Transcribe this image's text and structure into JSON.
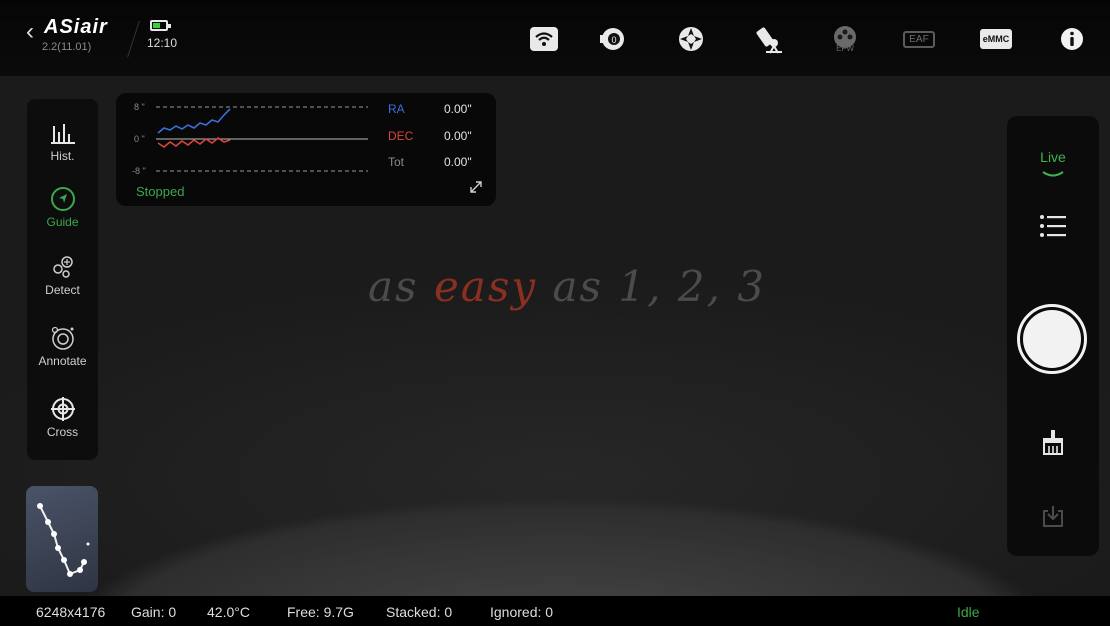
{
  "app": {
    "brand": "ASiair",
    "version": "2.2(11.01)",
    "clock": "12:10"
  },
  "topbar": {
    "icons": [
      "wifi-icon",
      "camera-icon",
      "guide-scope-icon",
      "mount-icon",
      "efw-icon",
      "eaf-icon",
      "emmc-icon",
      "info-icon"
    ],
    "efw_label": "EFW",
    "eaf_label": "EAF",
    "emmc_label": "eMMC"
  },
  "left_tools": [
    {
      "label": "Hist.",
      "icon": "histogram-icon",
      "active": false
    },
    {
      "label": "Guide",
      "icon": "guide-arrow-icon",
      "active": true
    },
    {
      "label": "Detect",
      "icon": "detect-stars-icon",
      "active": false
    },
    {
      "label": "Annotate",
      "icon": "annotate-icon",
      "active": false
    },
    {
      "label": "Cross",
      "icon": "crosshair-icon",
      "active": false
    }
  ],
  "guide_panel": {
    "ticks": [
      "8 \"",
      "0 \"",
      "-8 \""
    ],
    "rows": [
      {
        "label": "RA",
        "value": "0.00\"",
        "color": "#3d6fd8"
      },
      {
        "label": "DEC",
        "value": "0.00\"",
        "color": "#d8453d"
      },
      {
        "label": "Tot",
        "value": "0.00\"",
        "color": "#8a8a8a"
      }
    ],
    "status": "Stopped"
  },
  "slogan": {
    "part1": "as ",
    "highlight": "easy",
    "part2": " as 1, 2, 3"
  },
  "right_panel": {
    "mode": "Live"
  },
  "status_bar": {
    "resolution": "6248x4176",
    "gain": "Gain: 0",
    "temp": "42.0°C",
    "free": "Free: 9.7G",
    "stacked": "Stacked: 0",
    "ignored": "Ignored: 0",
    "state": "Idle"
  },
  "colors": {
    "accent_green": "#3aa94a",
    "ra_blue": "#3d6fd8",
    "dec_red": "#d8453d"
  }
}
